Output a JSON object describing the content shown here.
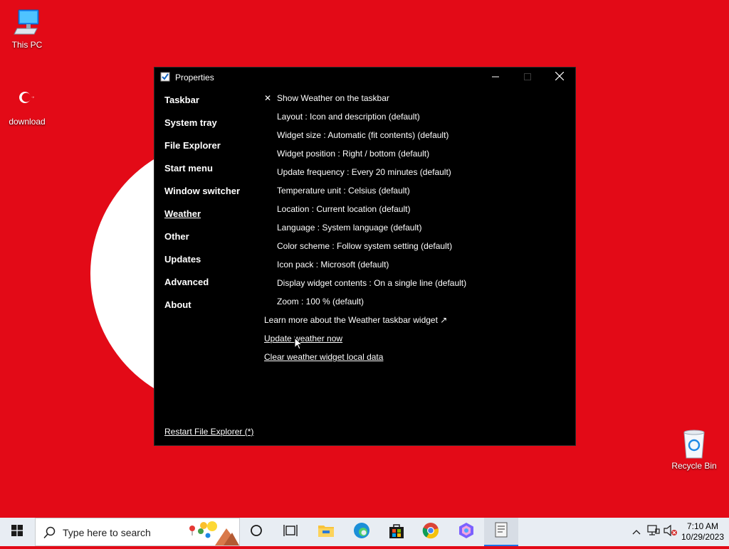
{
  "desktop": {
    "icons": [
      {
        "label": "This PC"
      },
      {
        "label": "download"
      },
      {
        "label": "Recycle Bin"
      }
    ]
  },
  "window": {
    "title": "Properties",
    "nav": [
      {
        "label": "Taskbar"
      },
      {
        "label": "System tray"
      },
      {
        "label": "File Explorer"
      },
      {
        "label": "Start menu"
      },
      {
        "label": "Window switcher"
      },
      {
        "label": "Weather"
      },
      {
        "label": "Other"
      },
      {
        "label": "Updates"
      },
      {
        "label": "Advanced"
      },
      {
        "label": "About"
      }
    ],
    "active_nav": "Weather",
    "check_mark": "✕",
    "settings": [
      {
        "label": "Show Weather on the taskbar"
      },
      {
        "label": "Layout : Icon and description (default)"
      },
      {
        "label": "Widget size : Automatic (fit contents) (default)"
      },
      {
        "label": "Widget position : Right / bottom (default)"
      },
      {
        "label": "Update frequency : Every 20 minutes (default)"
      },
      {
        "label": "Temperature unit : Celsius (default)"
      },
      {
        "label": "Location : Current location (default)"
      },
      {
        "label": "Language : System language (default)"
      },
      {
        "label": "Color scheme : Follow system setting (default)"
      },
      {
        "label": "Icon pack : Microsoft (default)"
      },
      {
        "label": "Display widget contents : On a single line (default)"
      },
      {
        "label": "Zoom : 100 % (default)"
      }
    ],
    "links": [
      {
        "label": "Learn more about the Weather taskbar widget ↗"
      },
      {
        "label": "Update weather now"
      },
      {
        "label": "Clear weather widget local data"
      }
    ],
    "restart_label": "Restart File Explorer (*)"
  },
  "taskbar": {
    "search_placeholder": "Type here to search",
    "clock_time": "7:10 AM",
    "clock_date": "10/29/2023"
  },
  "colors": {
    "desktop_bg": "#e30a17",
    "window_bg": "#000000",
    "taskbar_bg": "#e8edf3"
  }
}
